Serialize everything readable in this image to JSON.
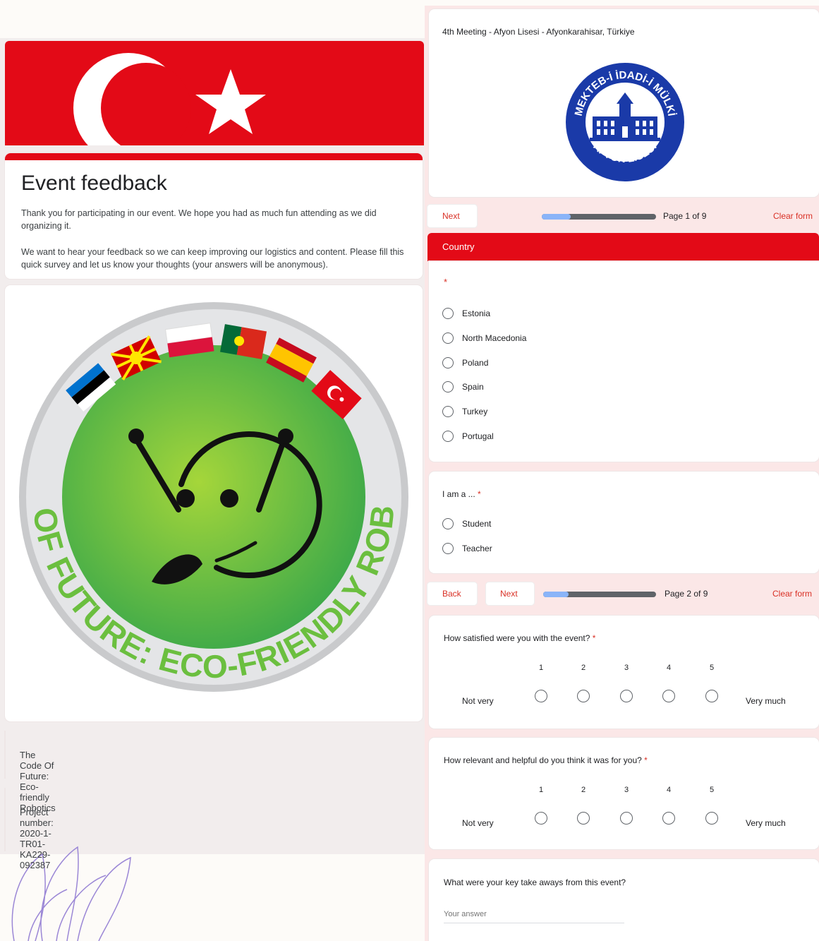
{
  "form": {
    "title": "Event feedback",
    "desc1": "Thank you for participating in our event. We hope you had as much fun attending as we did organizing it.",
    "desc2": "We want to hear your feedback so we can keep improving our logistics and content. Please fill this quick survey and let us know your thoughts (your answers will be anonymous).",
    "project_name": "The Code Of Future: Eco-friendly Robotics",
    "project_number": "Project number: 2020-1-TR01-KA229-092387"
  },
  "logo": {
    "text": "CODE OF FUTURE: ECO-FRIENDLY ROBOTICS",
    "seal_text_top": "MEKTEB-İ İDADİ-İ MÜLKİ",
    "seal_text_bottom": "AFYON LİSESİ"
  },
  "meeting": {
    "caption": "4th Meeting - Afyon Lisesi - Afyonkarahisar, Türkiye"
  },
  "nav1": {
    "next": "Next",
    "page": "Page 1 of 9",
    "clear": "Clear form",
    "progress": 0.111
  },
  "nav2": {
    "back": "Back",
    "next": "Next",
    "page": "Page 2 of 9",
    "clear": "Clear form",
    "progress": 0.222
  },
  "country": {
    "section": "Country",
    "required": "*",
    "options": [
      "Estonia",
      "North Macedonia",
      "Poland",
      "Spain",
      "Turkey",
      "Portugal"
    ]
  },
  "role": {
    "question": "I am a ...",
    "required": "*",
    "options": [
      "Student",
      "Teacher"
    ]
  },
  "q_satisfied": {
    "question": "How satisfied were you with the event?",
    "required": "*",
    "scale": [
      "1",
      "2",
      "3",
      "4",
      "5"
    ],
    "low": "Not very",
    "high": "Very much"
  },
  "q_relevant": {
    "question": "How relevant and helpful do you think it was for you?",
    "required": "*",
    "scale": [
      "1",
      "2",
      "3",
      "4",
      "5"
    ],
    "low": "Not very",
    "high": "Very much"
  },
  "q_takeaways": {
    "question": "What were your key take aways from this event?",
    "placeholder": "Your answer"
  },
  "colors": {
    "flag_red": "#e30a17",
    "accent_red": "#d93025",
    "progress_blue": "#8ab4f8"
  }
}
